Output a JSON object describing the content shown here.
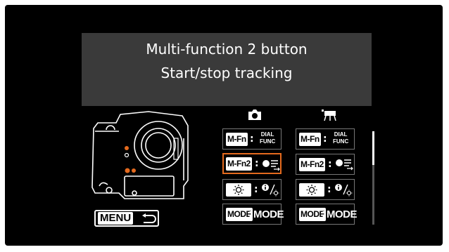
{
  "header": {
    "line1": "Multi-function 2 button",
    "line2": "Start/stop tracking"
  },
  "columns": [
    {
      "icon": "still-camera-icon"
    },
    {
      "icon": "movie-camera-icon"
    }
  ],
  "rows": [
    {
      "badge": "M-Fn",
      "value_top": "DIAL",
      "value_bottom": "FUNC"
    },
    {
      "badge": "M-Fn2",
      "value_icon": "af-tracking-icon",
      "selected_column": 0
    },
    {
      "badge_icon": "brightness-icon",
      "value_icon": "info-brightness-icon"
    },
    {
      "badge": "MODE",
      "value": "MODE"
    }
  ],
  "colon": ":",
  "menu_button": {
    "label": "MENU",
    "icon": "return-arrow-icon"
  },
  "scroll": {
    "position": 0
  }
}
